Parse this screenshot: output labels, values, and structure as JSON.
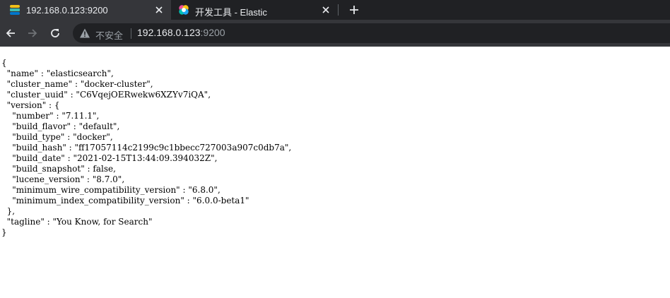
{
  "tabs": [
    {
      "title": "192.168.0.123:9200",
      "icon": "elasticsearch-icon",
      "active": true
    },
    {
      "title": "开发工具 - Elastic",
      "icon": "kibana-icon",
      "active": false
    }
  ],
  "omnibox": {
    "security_label": "不安全",
    "host": "192.168.0.123",
    "port": ":9200"
  },
  "response": {
    "lines": [
      "{",
      "  \"name\" : \"elasticsearch\",",
      "  \"cluster_name\" : \"docker-cluster\",",
      "  \"cluster_uuid\" : \"C6VqejOERwekw6XZYv7iQA\",",
      "  \"version\" : {",
      "    \"number\" : \"7.11.1\",",
      "    \"build_flavor\" : \"default\",",
      "    \"build_type\" : \"docker\",",
      "    \"build_hash\" : \"ff17057114c2199c9c1bbecc727003a907c0db7a\",",
      "    \"build_date\" : \"2021-02-15T13:44:09.394032Z\",",
      "    \"build_snapshot\" : false,",
      "    \"lucene_version\" : \"8.7.0\",",
      "    \"minimum_wire_compatibility_version\" : \"6.8.0\",",
      "    \"minimum_index_compatibility_version\" : \"6.0.0-beta1\"",
      "  },",
      "  \"tagline\" : \"You Know, for Search\"",
      "}"
    ]
  },
  "colors": {
    "tabbar_bg": "#202124",
    "active_tab_bg": "#35363a",
    "omnibox_bg": "#202124"
  }
}
